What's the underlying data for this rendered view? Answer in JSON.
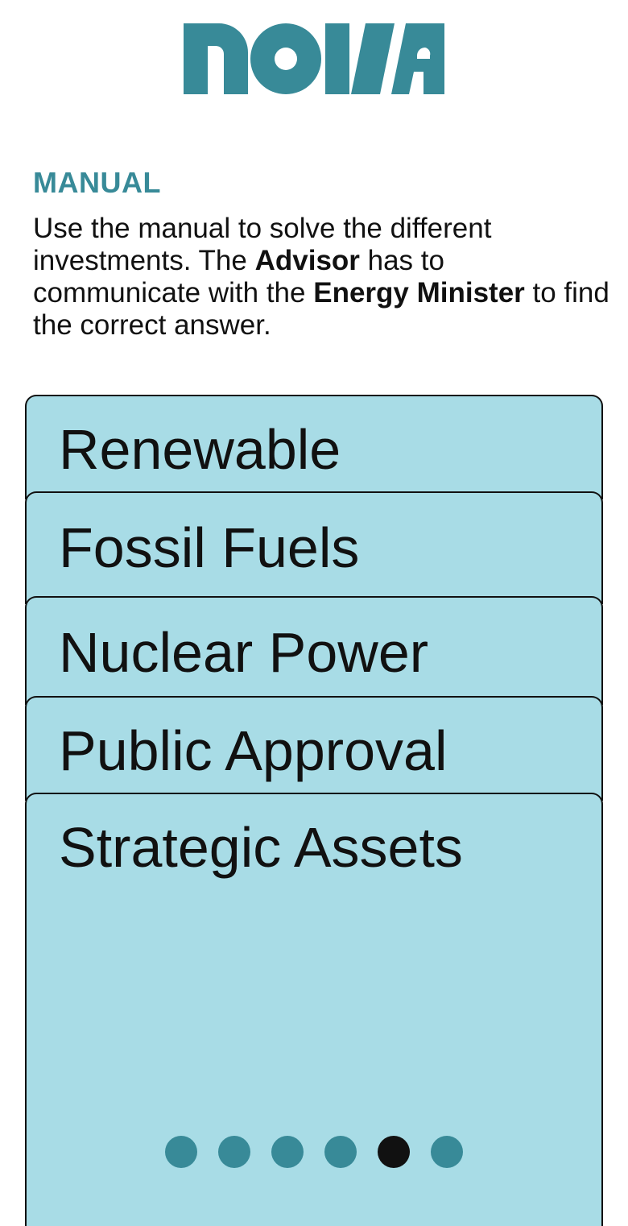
{
  "logo": {
    "text": "NOVA",
    "color": "#388a98"
  },
  "manual": {
    "title": "MANUAL",
    "text_1": "Use the manual to solve the different investments. The ",
    "bold_1": "Advisor",
    "text_2": " has to communicate with the ",
    "bold_2": "Energy Minister",
    "text_3": " to find the correct answer."
  },
  "tabs": [
    {
      "label": "Renewable"
    },
    {
      "label": "Fossil Fuels"
    },
    {
      "label": "Nuclear Power"
    },
    {
      "label": "Public Approval"
    },
    {
      "label": "Strategic Assets"
    }
  ],
  "pagination": {
    "total_pages": 6,
    "current_page": 5
  },
  "colors": {
    "accent": "#388a98",
    "panel": "#a8dce6",
    "text": "#111111",
    "dot_active": "#111111"
  }
}
